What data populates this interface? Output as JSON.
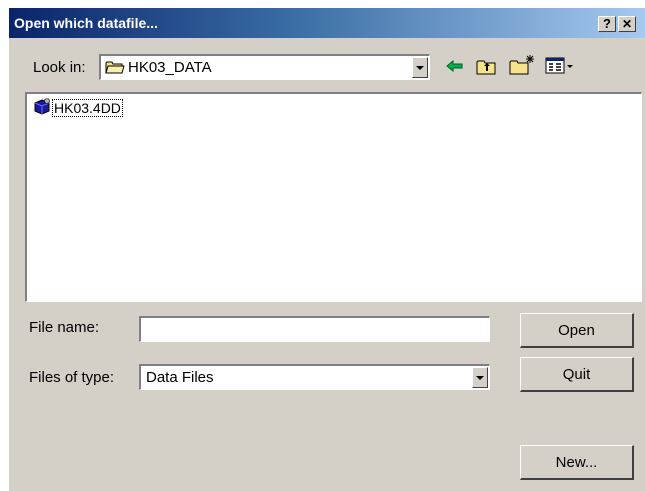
{
  "window": {
    "title": "Open which datafile...",
    "help_label": "?",
    "close_label": "✕"
  },
  "look_in": {
    "label": "Look in:",
    "value": "HK03_DATA"
  },
  "toolbar": {
    "icons": [
      "back-arrow-icon",
      "up-folder-icon",
      "new-folder-icon",
      "view-menu-icon"
    ]
  },
  "files": [
    {
      "name": "HK03.4DD",
      "icon": "datafile-icon"
    }
  ],
  "form": {
    "file_name_label": "File name:",
    "file_name_value": "",
    "files_of_type_label": "Files of type:",
    "files_of_type_value": "Data Files"
  },
  "buttons": {
    "open": "Open",
    "quit": "Quit",
    "new": "New..."
  },
  "colors": {
    "titlebar_start": "#0a246a",
    "titlebar_end": "#a6caf0",
    "dialog_face": "#d4d0c8"
  }
}
